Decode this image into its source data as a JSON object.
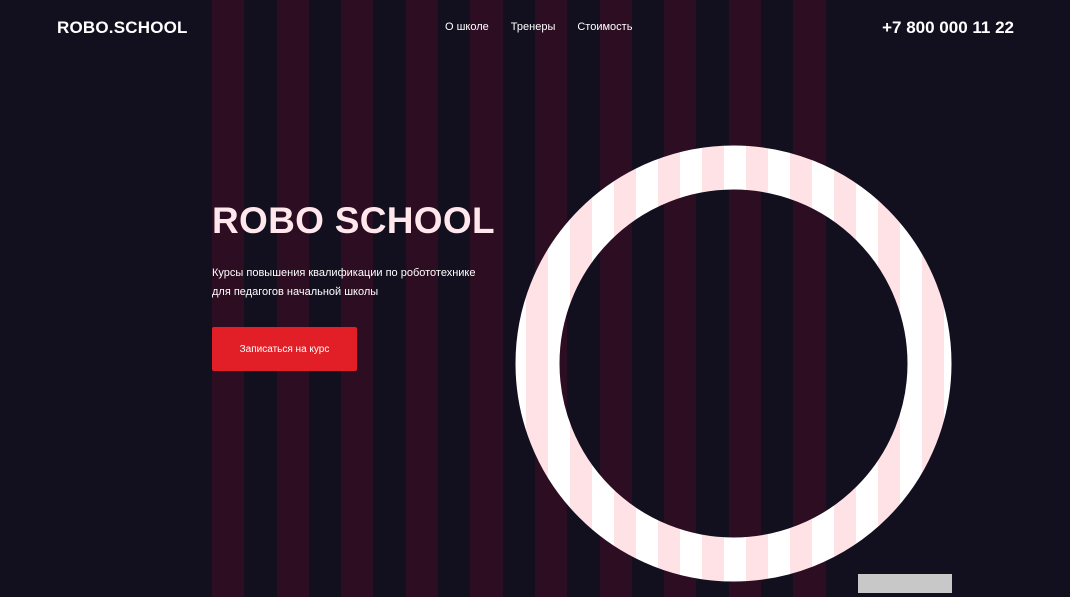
{
  "header": {
    "logo": "ROBO.SCHOOL",
    "nav": [
      {
        "label": "О школе"
      },
      {
        "label": "Тренеры"
      },
      {
        "label": "Стоимость"
      }
    ],
    "phone": "+7 800 000 11 22"
  },
  "hero": {
    "title": "ROBO SCHOOL",
    "subtitle_lines": [
      "Курсы повышения квалификации по робототехнике",
      "для педагогов начальной школы"
    ],
    "cta_label": "Записаться на курс"
  },
  "colors": {
    "background": "#12101f",
    "stripe": "#2d0d22",
    "accent": "#e21f26",
    "ring_white": "#ffffff",
    "ring_pink": "#ffe2e6"
  }
}
